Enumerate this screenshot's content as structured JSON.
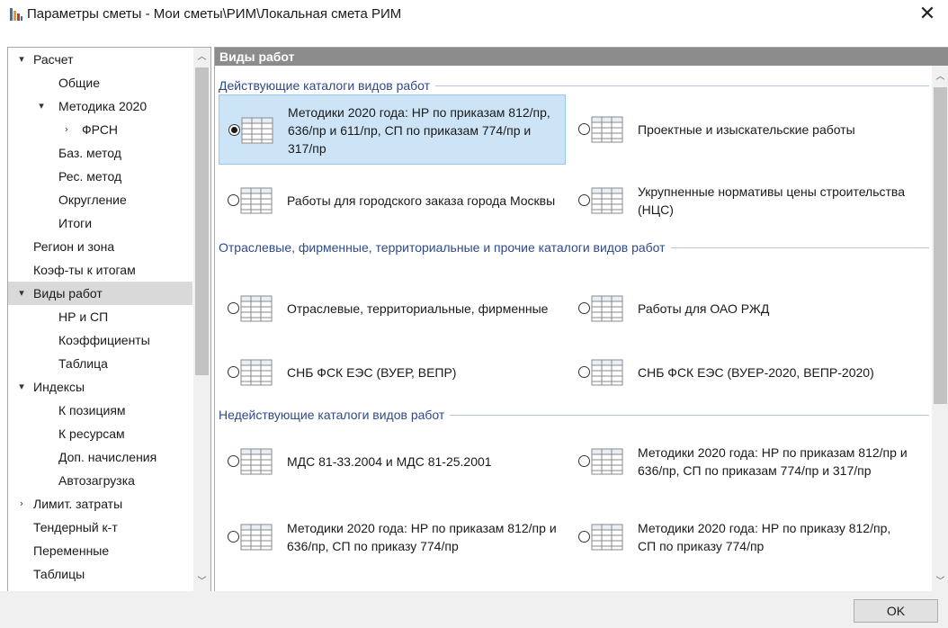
{
  "window": {
    "title": "Параметры сметы - Мои сметы\\РИМ\\Локальная смета РИМ",
    "close_symbol": "✕",
    "icon": "app-bars-icon"
  },
  "sidebar": {
    "items": [
      {
        "label": "Расчет",
        "expand": "▾"
      },
      {
        "label": "Общие"
      },
      {
        "label": "Методика 2020",
        "expand": "▾"
      },
      {
        "label": "ФРСН",
        "expand": "›"
      },
      {
        "label": "Баз. метод"
      },
      {
        "label": "Рес. метод"
      },
      {
        "label": "Округление"
      },
      {
        "label": "Итоги"
      },
      {
        "label": "Регион и зона"
      },
      {
        "label": "Коэф-ты к итогам"
      },
      {
        "label": "Виды работ",
        "expand": "▾",
        "selected": true
      },
      {
        "label": "НР и СП"
      },
      {
        "label": "Коэффициенты"
      },
      {
        "label": "Таблица"
      },
      {
        "label": "Индексы",
        "expand": "▾"
      },
      {
        "label": "К позициям"
      },
      {
        "label": "К ресурсам"
      },
      {
        "label": "Доп. начисления"
      },
      {
        "label": "Автозагрузка"
      },
      {
        "label": "Лимит. затраты",
        "expand": "›"
      },
      {
        "label": "Тендерный к-т"
      },
      {
        "label": "Переменные"
      },
      {
        "label": "Таблицы"
      }
    ],
    "scroll_up": "︿",
    "scroll_down": "﹀"
  },
  "main": {
    "header": "Виды работ",
    "sections": [
      {
        "title": "Действующие каталоги видов работ"
      },
      {
        "title": "Отраслевые, фирменные, территориальные и прочие каталоги видов работ"
      },
      {
        "title": "Недействующие каталоги видов работ"
      }
    ],
    "options": [
      {
        "label": "Методики 2020 года: НР по приказам 812/пр, 636/пр и 611/пр, СП по приказам 774/пр и 317/пр",
        "checked": true
      },
      {
        "label": "Проектные и изыскательские работы",
        "checked": false
      },
      {
        "label": "Работы для городского заказа города Москвы",
        "checked": false
      },
      {
        "label": "Укрупненные нормативы цены строительства (НЦС)",
        "checked": false
      },
      {
        "label": "Отраслевые, территориальные, фирменные",
        "checked": false
      },
      {
        "label": "Работы для ОАО РЖД",
        "checked": false
      },
      {
        "label": "СНБ ФСК ЕЭС (ВУЕР, ВЕПР)",
        "checked": false
      },
      {
        "label": "СНБ ФСК ЕЭС (ВУЕР-2020, ВЕПР-2020)",
        "checked": false
      },
      {
        "label": "МДС 81-33.2004 и МДС 81-25.2001",
        "checked": false
      },
      {
        "label": "Методики 2020 года: НР по приказам 812/пр и 636/пр, СП по приказам 774/пр и 317/пр",
        "checked": false
      },
      {
        "label": "Методики 2020 года: НР по приказам 812/пр и 636/пр, СП по приказу 774/пр",
        "checked": false
      },
      {
        "label": "Методики 2020 года: НР по приказу 812/пр, СП по приказу 774/пр",
        "checked": false
      }
    ],
    "option_icon": "catalog-table-icon"
  },
  "footer": {
    "ok_label": "OK"
  },
  "colors": {
    "header_bg": "#8c8c8c",
    "section_title": "#2e4a8a",
    "selected_option_bg": "#cde4f7",
    "selected_tree_bg": "#d9d9d9"
  }
}
